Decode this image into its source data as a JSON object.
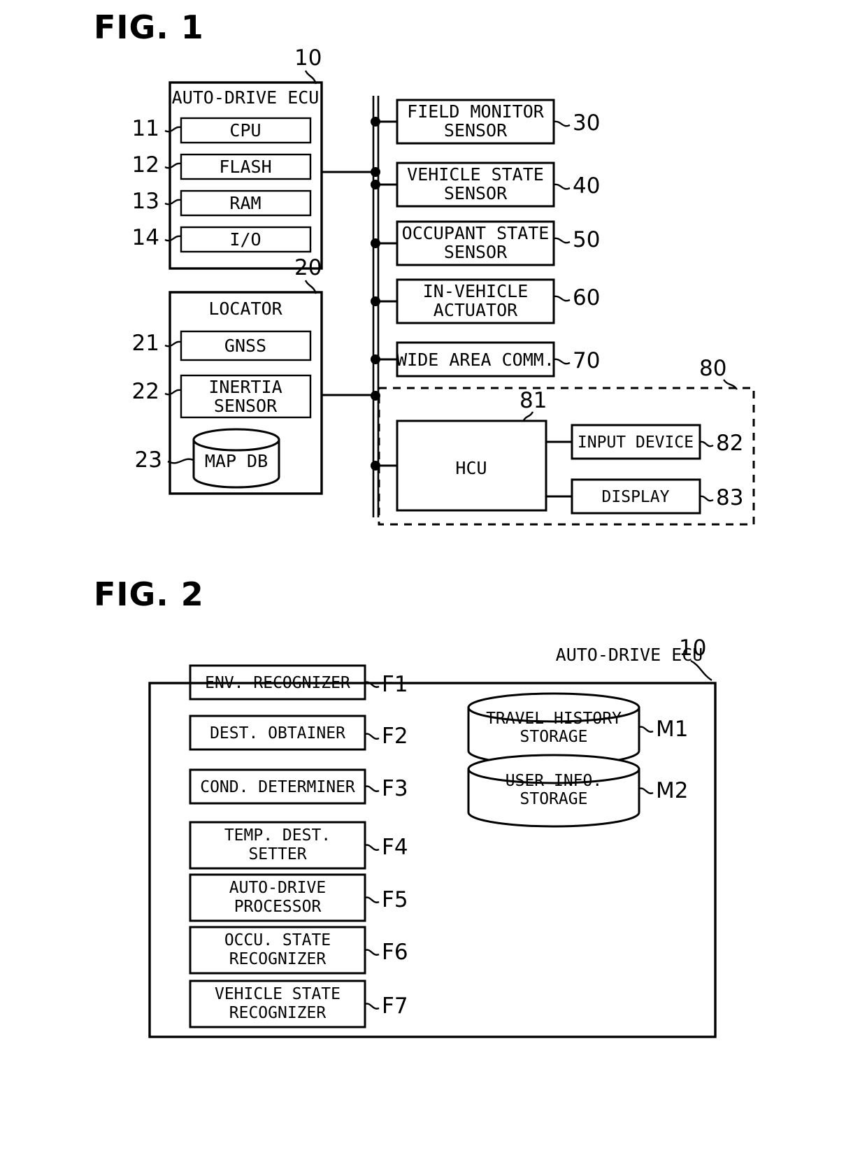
{
  "page": {
    "background": "#ffffff",
    "ink": "#000000"
  },
  "figures": [
    {
      "id": "fig1",
      "title": "FIG. 1",
      "ref": "10"
    },
    {
      "id": "fig2",
      "title": "FIG. 2",
      "ref": "10"
    }
  ],
  "fig1": {
    "title": "FIG. 1",
    "ecu": {
      "ref": "10",
      "title": "AUTO-DRIVE ECU",
      "items": [
        {
          "ref": "11",
          "label": "CPU"
        },
        {
          "ref": "12",
          "label": "FLASH"
        },
        {
          "ref": "13",
          "label": "RAM"
        },
        {
          "ref": "14",
          "label": "I/O"
        }
      ]
    },
    "locator": {
      "ref": "20",
      "title": "LOCATOR",
      "items": [
        {
          "ref": "21",
          "label": "GNSS",
          "shape": "box"
        },
        {
          "ref": "22",
          "label_line1": "INERTIA",
          "label_line2": "SENSOR",
          "shape": "box"
        },
        {
          "ref": "23",
          "label": "MAP DB",
          "shape": "cylinder"
        }
      ]
    },
    "bus_nodes": [
      {
        "ref": "30",
        "label_line1": "FIELD MONITOR",
        "label_line2": "SENSOR"
      },
      {
        "ref": "40",
        "label_line1": "VEHICLE STATE",
        "label_line2": "SENSOR"
      },
      {
        "ref": "50",
        "label_line1": "OCCUPANT STATE",
        "label_line2": "SENSOR"
      },
      {
        "ref": "60",
        "label_line1": "IN-VEHICLE",
        "label_line2": "ACTUATOR"
      },
      {
        "ref": "70",
        "label_line1": "WIDE AREA COMM.",
        "label_line2": ""
      }
    ],
    "hmi_group": {
      "ref": "80",
      "hcu": {
        "ref": "81",
        "label": "HCU"
      },
      "peripherals": [
        {
          "ref": "82",
          "label": "INPUT DEVICE"
        },
        {
          "ref": "83",
          "label": "DISPLAY"
        }
      ]
    }
  },
  "fig2": {
    "title": "FIG. 2",
    "ref": "10",
    "ecu_title": "AUTO-DRIVE ECU",
    "functions": [
      {
        "ref": "F1",
        "label_line1": "ENV. RECOGNIZER",
        "label_line2": ""
      },
      {
        "ref": "F2",
        "label_line1": "DEST. OBTAINER",
        "label_line2": ""
      },
      {
        "ref": "F3",
        "label_line1": "COND. DETERMINER",
        "label_line2": ""
      },
      {
        "ref": "F4",
        "label_line1": "TEMP. DEST.",
        "label_line2": "SETTER"
      },
      {
        "ref": "F5",
        "label_line1": "AUTO-DRIVE",
        "label_line2": "PROCESSOR"
      },
      {
        "ref": "F6",
        "label_line1": "OCCU. STATE",
        "label_line2": "RECOGNIZER"
      },
      {
        "ref": "F7",
        "label_line1": "VEHICLE STATE",
        "label_line2": "RECOGNIZER"
      }
    ],
    "storages": [
      {
        "ref": "M1",
        "label_line1": "TRAVEL HISTORY",
        "label_line2": "STORAGE"
      },
      {
        "ref": "M2",
        "label_line1": "USER INFO.",
        "label_line2": "STORAGE"
      }
    ]
  }
}
